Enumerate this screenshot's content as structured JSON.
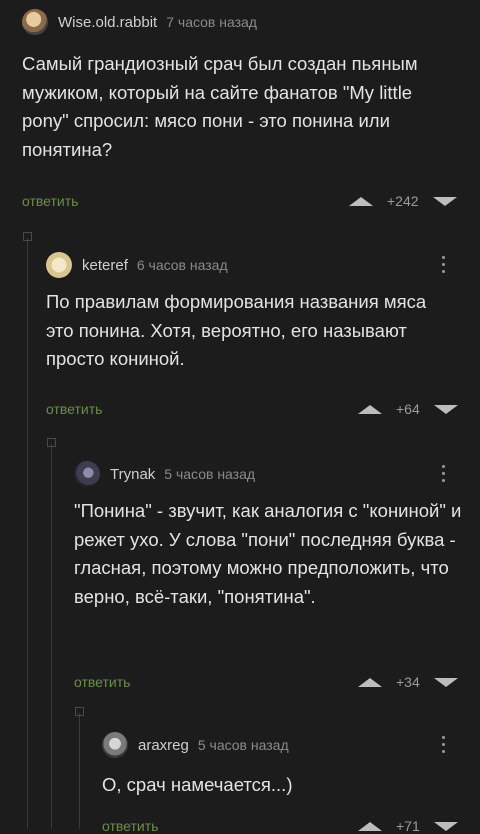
{
  "comments": [
    {
      "author": "Wise.old.rabbit",
      "time": "7 часов назад",
      "text": "Самый грандиозный срач был создан пьяным мужиком, который на сайте фанатов \"My little pony\" спросил: мясо пони - это понина или понятина?",
      "reply": "ответить",
      "rating": "+242"
    },
    {
      "author": "keteref",
      "time": "6 часов назад",
      "text": "По правилам формирования названия мяса это понина. Хотя, вероятно, его называют просто кониной.",
      "reply": "ответить",
      "rating": "+64"
    },
    {
      "author": "Trynak",
      "time": "5 часов назад",
      "text": "\"Понина\" - звучит, как аналогия с \"кониной\" и режет ухо. У слова \"пони\" последняя буква - гласная, поэтому можно предположить, что верно, всё-таки, \"понятина\".",
      "reply": "ответить",
      "rating": "+34"
    },
    {
      "author": "araxreg",
      "time": "5 часов назад",
      "text": "О, срач намечается...)",
      "reply": "ответить",
      "rating": "+71"
    }
  ],
  "colors": {
    "background": "#1c1c1c",
    "reply_link": "#6a8f46",
    "vote_arrows": "#bdbdbd"
  },
  "icons": [
    "more-vertical-icon",
    "upvote-arrow-icon",
    "downvote-arrow-icon",
    "collapse-thread-icon",
    "avatar"
  ]
}
